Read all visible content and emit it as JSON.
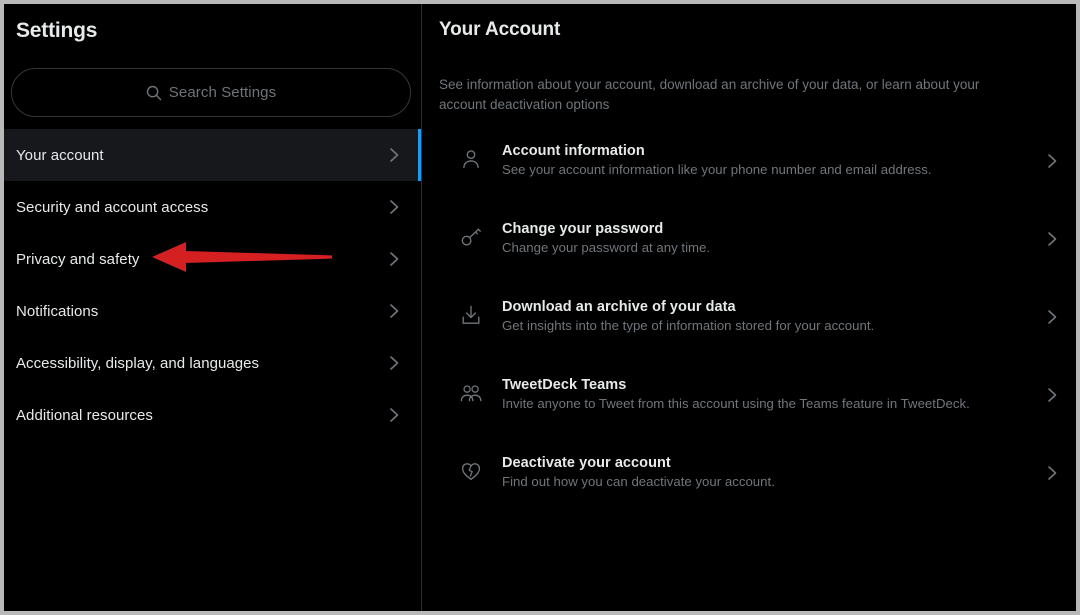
{
  "window": {
    "accent_color": "#1d9bf0",
    "background_color": "#000000",
    "selected_row_color": "#16181c",
    "annotation_color": "#d42020"
  },
  "sidebar": {
    "title": "Settings",
    "search": {
      "placeholder": "Search Settings",
      "value": "",
      "icon": "search-icon"
    },
    "items": [
      {
        "label": "Your account",
        "selected": true,
        "icon": "chevron-right-icon"
      },
      {
        "label": "Security and account access",
        "selected": false,
        "icon": "chevron-right-icon"
      },
      {
        "label": "Privacy and safety",
        "selected": false,
        "icon": "chevron-right-icon"
      },
      {
        "label": "Notifications",
        "selected": false,
        "icon": "chevron-right-icon"
      },
      {
        "label": "Accessibility, display, and languages",
        "selected": false,
        "icon": "chevron-right-icon"
      },
      {
        "label": "Additional resources",
        "selected": false,
        "icon": "chevron-right-icon"
      }
    ]
  },
  "main": {
    "title": "Your Account",
    "description": "See information about your account, download an archive of your data, or learn about your account deactivation options",
    "rows": [
      {
        "title": "Account information",
        "subtitle": "See your account information like your phone number and email address.",
        "icon": "person-icon",
        "chevron": "chevron-right-icon"
      },
      {
        "title": "Change your password",
        "subtitle": "Change your password at any time.",
        "icon": "key-icon",
        "chevron": "chevron-right-icon"
      },
      {
        "title": "Download an archive of your data",
        "subtitle": "Get insights into the type of information stored for your account.",
        "icon": "download-icon",
        "chevron": "chevron-right-icon"
      },
      {
        "title": "TweetDeck Teams",
        "subtitle": "Invite anyone to Tweet from this account using the Teams feature in TweetDeck.",
        "icon": "people-icon",
        "chevron": "chevron-right-icon"
      },
      {
        "title": "Deactivate your account",
        "subtitle": "Find out how you can deactivate your account.",
        "icon": "broken-heart-icon",
        "chevron": "chevron-right-icon"
      }
    ]
  },
  "annotation": {
    "type": "arrow-left",
    "target": "Privacy and safety",
    "color": "#d42020"
  }
}
